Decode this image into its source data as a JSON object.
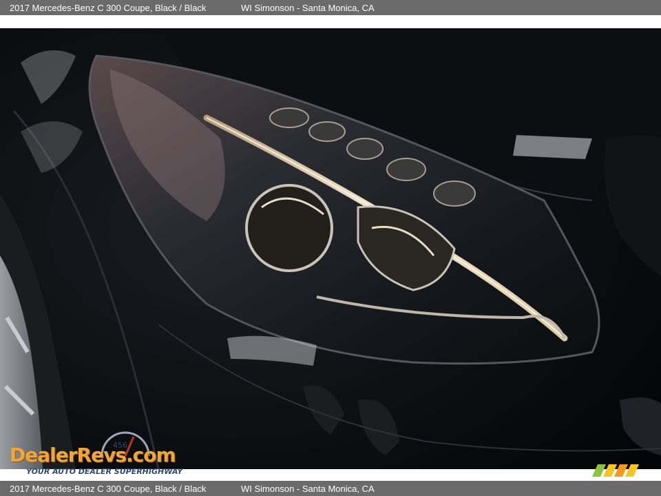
{
  "header": {
    "vehicle": "2017 Mercedes-Benz C 300 Coupe,   Black / Black",
    "dealer": "WI Simonson - Santa Monica, CA"
  },
  "footer": {
    "vehicle": "2017 Mercedes-Benz C 300 Coupe,   Black / Black",
    "dealer": "WI Simonson - Santa Monica, CA"
  },
  "watermark": {
    "brand": "DealerRevs.com",
    "tagline": "YOUR AUTO DEALER SUPERHIGHWAY",
    "gauge_digits": "456"
  },
  "photo": {
    "subject": "headlight",
    "colors": {
      "paint": "#07090c",
      "chrome": "#c9c3b8",
      "drl": "#f3e6c8"
    }
  }
}
